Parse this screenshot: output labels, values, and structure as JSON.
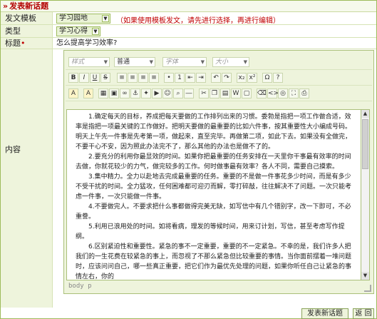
{
  "header": {
    "title": "发表新话题"
  },
  "fields": {
    "template": {
      "label": "发文模板",
      "value": "学习园地",
      "hint": "（如果使用模板发文，请先进行选择，再进行编辑）"
    },
    "type": {
      "label": "类型",
      "value": "学习心得"
    },
    "title": {
      "label": "标题",
      "value": "怎么提高学习效率?"
    },
    "content": {
      "label": "内容"
    }
  },
  "toolbar": {
    "format_placeholder": "样式",
    "paragraph_value": "普通",
    "font_placeholder": "字体",
    "size_placeholder": "大小"
  },
  "editor": {
    "paragraphs": [
      "1.确定每天的目标，养成把每天要做的工作排列出来的习惯。委勃是指把一项工作做合适，效率是指把一项最关键的工作做好。把明天要做的最重要的比如六件事，按其重要性大小编成号码。明天上午先一件事是先考第一项，做起来，直至完毕。再做第二项，如此下去。如果没有全做完，不要干心不安，因为照此办法完不了，那么其他的办法也是做不了的。",
      "2.要充分的利用你最显效的时间。如果你把最重要的任务安排在一天里你干事最有效率的时间去做，你就花较少的力气，做完较多的工作。何时做事最有效率？各人不同，需要自己摸索。",
      "3.集中精力。全力以赴地去完成最重要的任务。重要的不是做一件事花多少时间，而是有多少不受干扰的时间。全力猛攻，任何困难都可迎刃而解，零打碎敲，往往解决不了问题。一次只能考虑一件事，一次只能做一件事。",
      "4.不要做完人。不要求把什么事都做得完美无缺，如写信中有几个错别字，改一下即可，不必重誊。",
      "5.利用已浪用处的时间。如将看病，理发的等候时间，用来订计划，写信，甚至考虑写作提纲。",
      "6.区别紧迫性和重要性。紧急的事不一定重要，重要的不一定紧急。不幸的是，我们许多人把我们的一生花费在较紧急的事上，而忽视了不那么紧急但比较重要的事情。当你面前摆着一堆问题时，应该问问自己，哪一些真正重要，把它们作为最优先处理的问题，如果你听任自己让紧急的事情左右，你的"
    ],
    "status_path": "body p"
  },
  "buttons": {
    "submit": "发表新话题",
    "back": "返 回"
  },
  "colors": {
    "accent": "#9dbb5b",
    "label_bg": "#eef4dc",
    "warning": "#c00000"
  }
}
